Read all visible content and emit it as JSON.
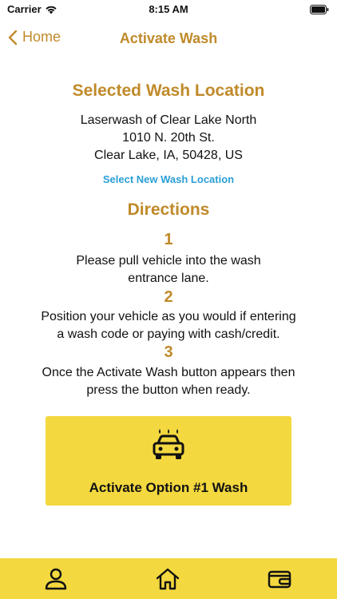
{
  "status_bar": {
    "carrier": "Carrier",
    "time": "8:15 AM"
  },
  "nav": {
    "back_label": "Home",
    "title": "Activate Wash"
  },
  "location": {
    "heading": "Selected Wash Location",
    "name": "Laserwash of Clear Lake North",
    "street": "1010 N. 20th St.",
    "city_line": "Clear Lake, IA, 50428, US",
    "change_link": "Select New Wash Location"
  },
  "directions": {
    "heading": "Directions",
    "steps": [
      {
        "number": "1",
        "line1": "Please pull vehicle into the wash",
        "line2": "entrance lane."
      },
      {
        "number": "2",
        "line1": "Position your vehicle as you would if entering",
        "line2": "a wash code or paying with cash/credit."
      },
      {
        "number": "3",
        "line1": "Once the Activate Wash button appears then",
        "line2": "press the button when ready."
      }
    ]
  },
  "activate": {
    "label": "Activate Option #1 Wash",
    "icon": "car-wash-icon"
  },
  "tab_bar": {
    "items": [
      "profile-icon",
      "home-icon",
      "wallet-icon"
    ]
  },
  "colors": {
    "accent": "#c08a2a",
    "link": "#2a9fd6",
    "button": "#f3d83f"
  }
}
